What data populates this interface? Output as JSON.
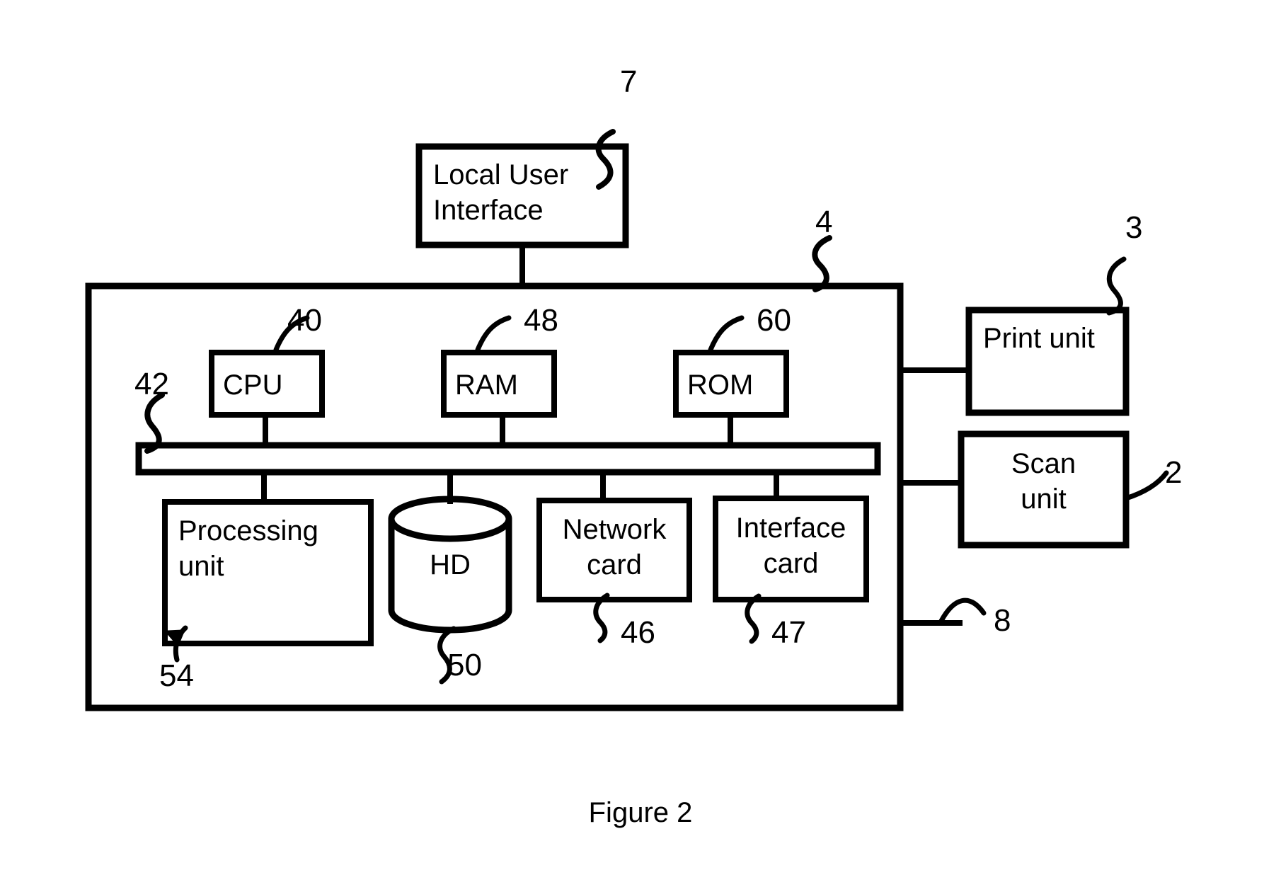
{
  "figure": {
    "caption": "Figure 2"
  },
  "blocks": {
    "local_user_interface": {
      "label": "Local User\nInterface"
    },
    "cpu": {
      "label": "CPU"
    },
    "ram": {
      "label": "RAM"
    },
    "rom": {
      "label": "ROM"
    },
    "processing_unit": {
      "label": "Processing\nunit"
    },
    "hd": {
      "label": "HD"
    },
    "network_card": {
      "label": "Network\ncard"
    },
    "interface_card": {
      "label": "Interface\ncard"
    },
    "print_unit": {
      "label": "Print unit"
    },
    "scan_unit": {
      "label": "Scan\nunit"
    }
  },
  "reference_numerals": {
    "local_user_interface": "7",
    "controller_housing": "4",
    "print_unit": "3",
    "scan_unit": "2",
    "cpu": "40",
    "bus": "42",
    "ram": "48",
    "rom": "60",
    "network_card": "46",
    "interface_card": "47",
    "hd": "50",
    "processing_unit": "54",
    "external_connection": "8"
  },
  "style": {
    "stroke": "#000000",
    "background": "#ffffff"
  }
}
